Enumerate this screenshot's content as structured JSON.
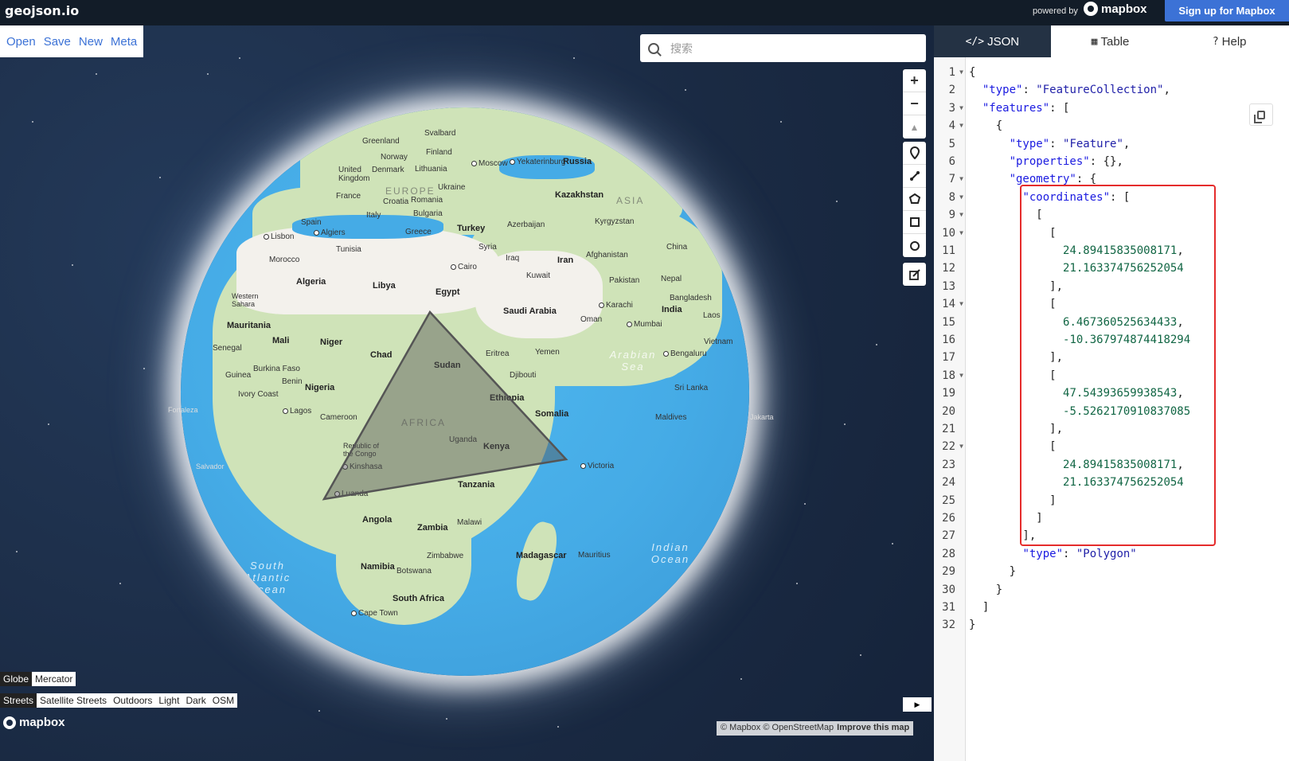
{
  "topbar": {
    "brand": "geojson.io",
    "powered_by": "powered by",
    "mapbox_label": "mapbox",
    "signup_label": "Sign up for Mapbox"
  },
  "file_menu": [
    "Open",
    "Save",
    "New",
    "Meta"
  ],
  "search": {
    "placeholder": "搜索"
  },
  "map_controls": {
    "zoom_in": "+",
    "zoom_out": "−",
    "compass": "▲",
    "draw_tools": [
      "marker-icon",
      "line-icon",
      "polygon-icon",
      "rectangle-icon",
      "circle-icon",
      "edit-icon"
    ]
  },
  "map_labels": {
    "countries": [
      "Greenland",
      "Svalbard",
      "Norway",
      "Finland",
      "United Kingdom",
      "Denmark",
      "Lithuania",
      "Moscow",
      "Yekaterinburg",
      "Russia",
      "France",
      "Croatia",
      "Romania",
      "Ukraine",
      "Kazakhstan",
      "Spain",
      "Italy",
      "Bulgaria",
      "Azerbaijan",
      "Kyrgyzstan",
      "Lisbon",
      "Algiers",
      "Greece",
      "Turkey",
      "China",
      "Morocco",
      "Tunisia",
      "Syria",
      "Iraq",
      "Afghanistan",
      "Cairo",
      "Kuwait",
      "Iran",
      "Pakistan",
      "Nepal",
      "Algeria",
      "Libya",
      "Egypt",
      "Western Sahara",
      "Saudi Arabia",
      "Bangladesh",
      "Karachi",
      "India",
      "Mauritania",
      "Oman",
      "Mumbai",
      "Laos",
      "Mali",
      "Niger",
      "Chad",
      "Sudan",
      "Eritrea",
      "Yemen",
      "Vietnam",
      "Senegal",
      "Bengaluru",
      "Burkina Faso",
      "Guinea",
      "Benin",
      "Djibouti",
      "Nigeria",
      "Ethiopia",
      "Sri Lanka",
      "Ivory Coast",
      "Lagos",
      "Cameroon",
      "Somalia",
      "Maldives",
      "Republic of the Congo",
      "Uganda",
      "Kenya",
      "Kinshasa",
      "Tanzania",
      "Luanda",
      "Angola",
      "Zambia",
      "Malawi",
      "Madagascar",
      "Mauritius",
      "Zimbabwe",
      "Namibia",
      "Botswana",
      "South Africa",
      "Cape Town",
      "Victoria"
    ],
    "regions": [
      "EUROPE",
      "ASIA",
      "AFRICA"
    ],
    "oceans": [
      "Arabian Sea",
      "South Atlantic Ocean",
      "Indian Ocean"
    ],
    "outside": [
      "Fortaleza",
      "Salvador",
      "Jakarta"
    ]
  },
  "projection": {
    "options": [
      "Globe",
      "Mercator"
    ],
    "selected": "Mercator"
  },
  "styles": {
    "options": [
      "Streets",
      "Satellite Streets",
      "Outdoors",
      "Light",
      "Dark",
      "OSM"
    ],
    "selected": "Streets"
  },
  "mapbox_logo": "mapbox",
  "attribution": {
    "text": "© Mapbox © OpenStreetMap",
    "link": "Improve this map"
  },
  "collapse_button": "▶",
  "tabs": [
    {
      "icon": "</>",
      "label": "JSON"
    },
    {
      "icon": "▦",
      "label": "Table"
    },
    {
      "icon": "?",
      "label": "Help"
    }
  ],
  "active_tab": "JSON",
  "geojson": {
    "type": "FeatureCollection",
    "feature_type": "Feature",
    "geometry_type": "Polygon",
    "coordinates": [
      [
        24.89415835008171,
        21.163374756252054
      ],
      [
        6.467360525634433,
        -10.367974874418294
      ],
      [
        47.54393659938543,
        -5.5262170910837085
      ],
      [
        24.89415835008171,
        21.163374756252054
      ]
    ]
  },
  "code_lines": [
    "{",
    "  \"type\": \"FeatureCollection\",",
    "  \"features\": [",
    "    {",
    "      \"type\": \"Feature\",",
    "      \"properties\": {},",
    "      \"geometry\": {",
    "        \"coordinates\": [",
    "          [",
    "            [",
    "              24.89415835008171,",
    "              21.163374756252054",
    "            ],",
    "            [",
    "              6.467360525634433,",
    "              -10.367974874418294",
    "            ],",
    "            [",
    "              47.54393659938543,",
    "              -5.5262170910837085",
    "            ],",
    "            [",
    "              24.89415835008171,",
    "              21.163374756252054",
    "            ]",
    "          ]",
    "        ],",
    "        \"type\": \"Polygon\"",
    "      }",
    "    }",
    "  ]",
    "}"
  ],
  "colors": {
    "accent": "#3c72d6",
    "highlight_box": "#e52c2c",
    "polygon_stroke": "#555555",
    "polygon_fill": "#555555"
  }
}
